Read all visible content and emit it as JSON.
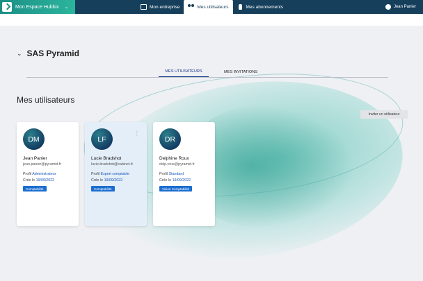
{
  "app": {
    "brand": "Mon Espace Hubbix"
  },
  "nav": {
    "items": [
      {
        "label": "Mon entreprise",
        "icon": "building-icon",
        "active": false
      },
      {
        "label": "Mes utilisateurs",
        "icon": "users-icon",
        "active": true
      },
      {
        "label": "Mes abonnements",
        "icon": "hand-icon",
        "active": false
      }
    ]
  },
  "user_menu": {
    "name": "Jean Panier"
  },
  "company": {
    "name": "SAS Pyramid"
  },
  "tabs": [
    {
      "label": "MES UTILISATEURS",
      "active": true
    },
    {
      "label": "MES INVITATIONS",
      "active": false
    }
  ],
  "section": {
    "title": "Mes utilisateurs",
    "invite_label": "Inviter un utilisateur"
  },
  "users": [
    {
      "initials": "DM",
      "name": "Jean Panier",
      "email": "jean.panier@pyramid.fr",
      "profile_label": "Profil",
      "profile": "Administrateur",
      "created_label": "Crée le",
      "created": "19/09/2022",
      "badge": "Comptabilité",
      "selected": false
    },
    {
      "initials": "LF",
      "name": "Lucie Bradshot",
      "email": "lucie.bradshot@cabinet.fr",
      "profile_label": "Profil",
      "profile": "Expert comptable",
      "created_label": "Crée le",
      "created": "19/09/2022",
      "badge": "Comptabilité",
      "selected": true
    },
    {
      "initials": "DR",
      "name": "Delphine Roux",
      "email": "delp.roux@pyramid.fr",
      "profile_label": "Profil",
      "profile": "Standard",
      "created_label": "Crée le",
      "created": "19/09/2022",
      "badge": "Vision Comptabilité",
      "selected": false
    }
  ],
  "colors": {
    "topbar": "#163f5c",
    "brand": "#2bb59c",
    "accent": "#1b6ed0"
  }
}
